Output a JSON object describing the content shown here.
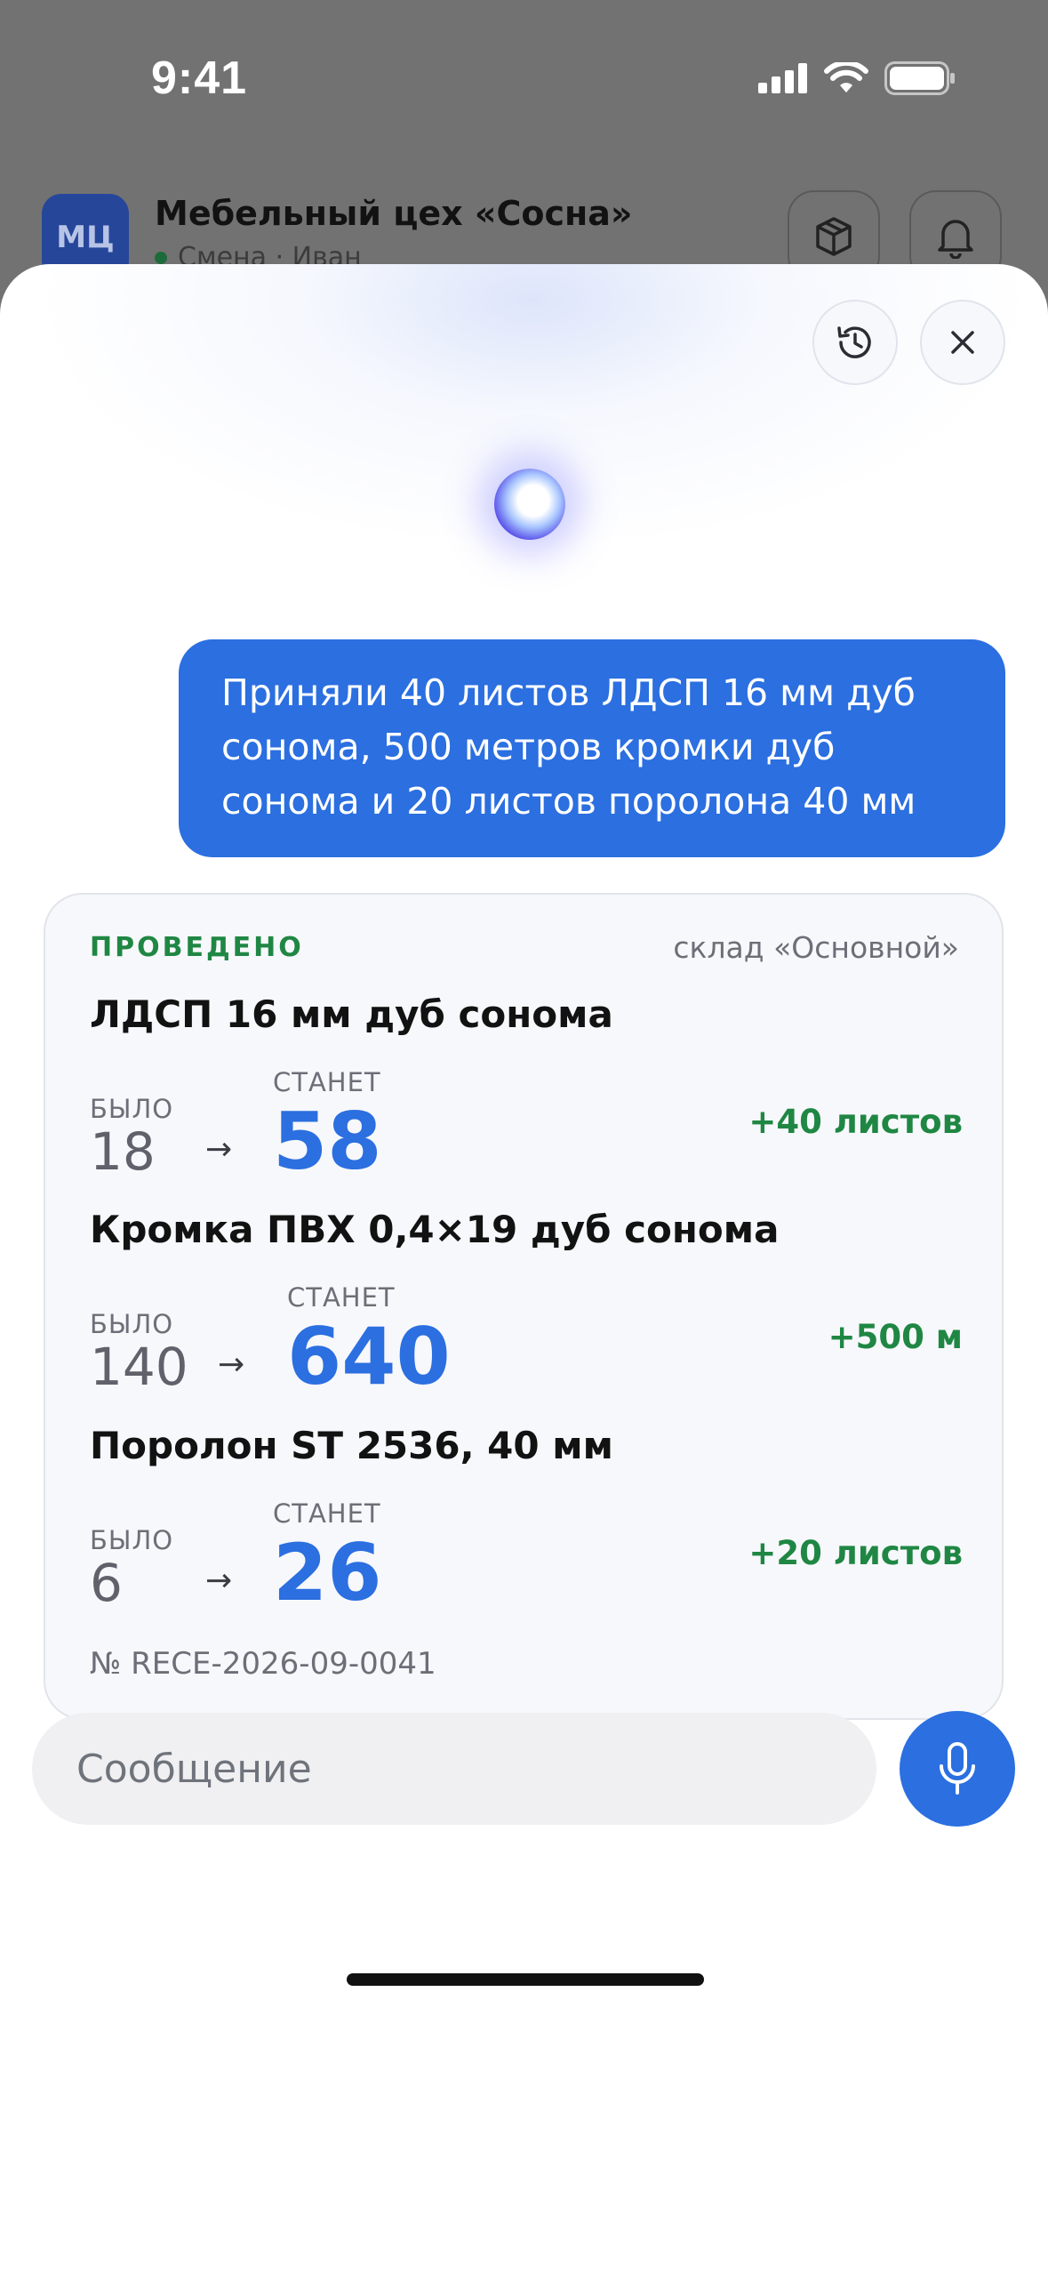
{
  "status_bar": {
    "time": "9:41"
  },
  "app_header": {
    "logo_text": "МЦ",
    "company_name": "Мебельный цех «Сосна»",
    "shift_text": "Смена · Иван"
  },
  "assistant": {
    "user_message": "Приняли 40 листов ЛДСП 16 мм дуб сонома, 500 метров кромки дуб сонома и 20 листов поролона 40 мм",
    "receipt": {
      "status": "ПРОВЕДЕНО",
      "warehouse": "склад «Основной»",
      "was_label": "БЫЛО",
      "will_label": "СТАНЕТ",
      "arrow": "→",
      "items": [
        {
          "name": "ЛДСП 16 мм дуб сонома",
          "was": "18",
          "will": "58",
          "delta": "+40 листов"
        },
        {
          "name": "Кромка ПВХ 0,4×19 дуб сонома",
          "was": "140",
          "will": "640",
          "delta": "+500 м"
        },
        {
          "name": "Поролон ST 2536, 40 мм",
          "was": "6",
          "will": "26",
          "delta": "+20 листов"
        }
      ],
      "document_number": "№ RECE-2026-09-0041"
    }
  },
  "composer": {
    "placeholder": "Сообщение",
    "value": ""
  },
  "colors": {
    "accent": "#2b6fe0",
    "success": "#1f8743",
    "overlay": "#727272"
  }
}
